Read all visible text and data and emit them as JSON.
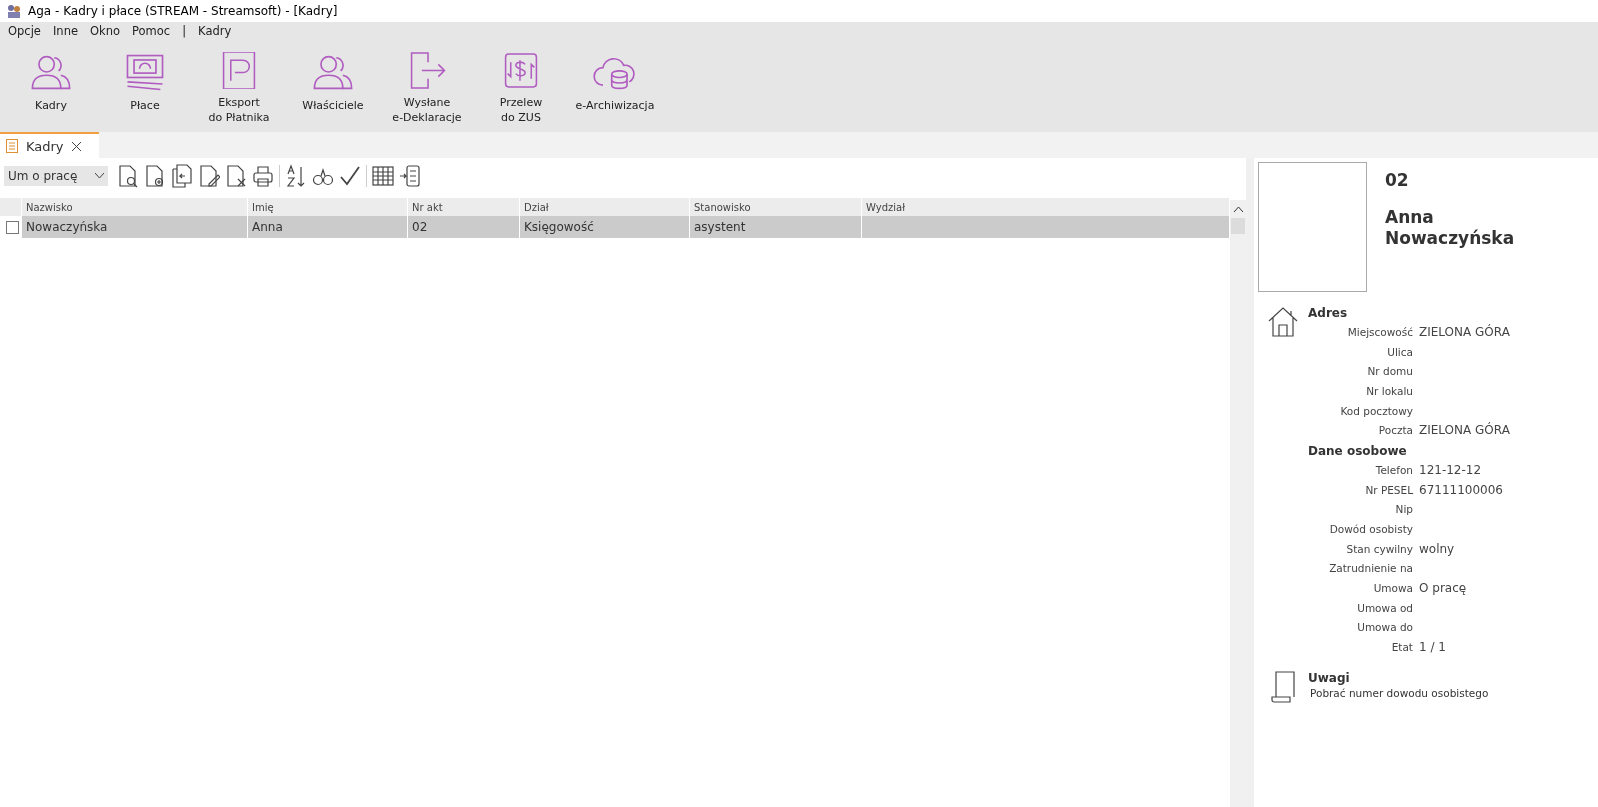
{
  "window": {
    "title": "Aga - Kadry i płace (STREAM - Streamsoft) - [Kadry]"
  },
  "menu": [
    "Opcje",
    "Inne",
    "Okno",
    "Pomoc",
    "|",
    "Kadry"
  ],
  "ribbon": [
    {
      "label": "Kadry"
    },
    {
      "label": "Płace"
    },
    {
      "label": "Eksport\ndo Płatnika"
    },
    {
      "label": "Właściciele"
    },
    {
      "label": "Wysłane\ne-Deklaracje"
    },
    {
      "label": "Przelew\ndo ZUS"
    },
    {
      "label": "e-Archiwizacja"
    }
  ],
  "tabs": [
    {
      "label": "Kadry",
      "selected": true
    }
  ],
  "filter": {
    "value": "Um o pracę"
  },
  "table": {
    "columns": [
      "Nazwisko",
      "Imię",
      "Nr akt",
      "Dział",
      "Stanowisko",
      "Wydział"
    ],
    "rows": [
      {
        "checked": false,
        "selected": true,
        "cells": [
          "Nowaczyńska",
          "Anna",
          "02",
          "Księgowość",
          "asystent"
        ]
      }
    ]
  },
  "detail": {
    "number": "02",
    "first_name": "Anna",
    "last_name": "Nowaczyńska",
    "sections": [
      {
        "title": "Adres",
        "fields": [
          {
            "label": "Miejscowość",
            "value": "ZIELONA GÓRA"
          },
          {
            "label": "Ulica"
          },
          {
            "label": "Nr domu"
          },
          {
            "label": "Nr lokalu"
          },
          {
            "label": "Kod pocztowy"
          },
          {
            "label": "Poczta",
            "value": "ZIELONA GÓRA"
          }
        ]
      },
      {
        "title": "Dane osobowe",
        "fields": [
          {
            "label": "Telefon",
            "value": "121-12-12"
          },
          {
            "label": "Nr PESEL",
            "value": "67111100006"
          },
          {
            "label": "Nip"
          },
          {
            "label": "Dowód osobisty"
          },
          {
            "label": "Stan cywilny",
            "value": "wolny"
          },
          {
            "label": "Zatrudnienie na"
          },
          {
            "label": "Umowa",
            "value": "O pracę"
          },
          {
            "label": "Umowa od"
          },
          {
            "label": "Umowa do"
          },
          {
            "label": "Etat",
            "value": "1 / 1"
          }
        ]
      }
    ],
    "notes": {
      "title": "Uwagi",
      "text": "Pobrać numer dowodu osobistego"
    }
  }
}
